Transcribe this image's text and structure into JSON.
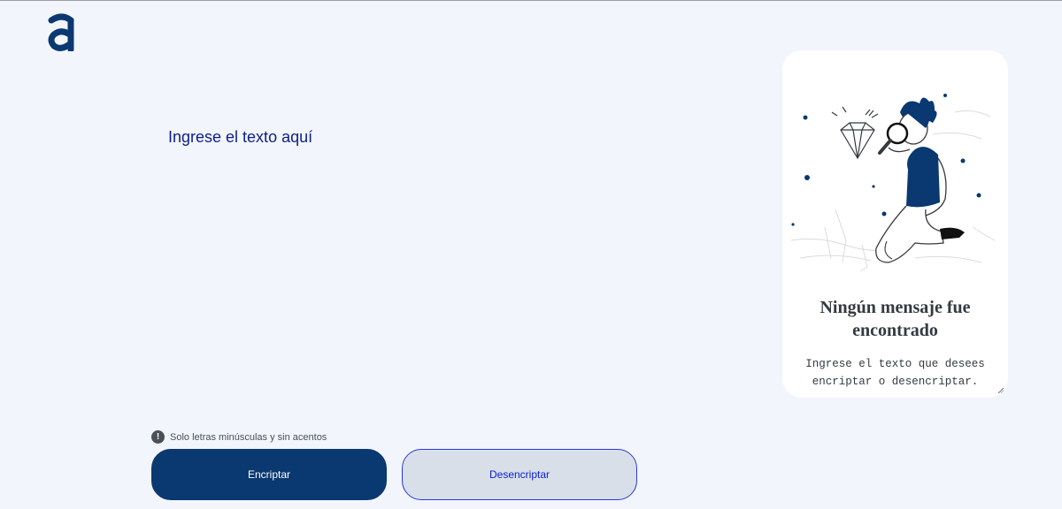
{
  "logo": {
    "icon": "alura-a-logo-icon",
    "color": "#0a3871"
  },
  "input": {
    "placeholder": "Ingrese el texto aquí",
    "value": ""
  },
  "hint": {
    "icon": "exclamation-icon",
    "text": "Solo letras minúsculas y sin acentos"
  },
  "buttons": {
    "encrypt_label": "Encriptar",
    "decrypt_label": "Desencriptar"
  },
  "output_card": {
    "illustration": "person-with-magnifying-glass-illustration",
    "title": "Ningún mensaje fue encontrado",
    "text": "Ingrese el texto que desees encriptar o desencriptar."
  },
  "colors": {
    "background": "#f3f5fc",
    "primary": "#0a3871",
    "secondary_bg": "#d8dfe8",
    "card_bg": "#ffffff"
  }
}
